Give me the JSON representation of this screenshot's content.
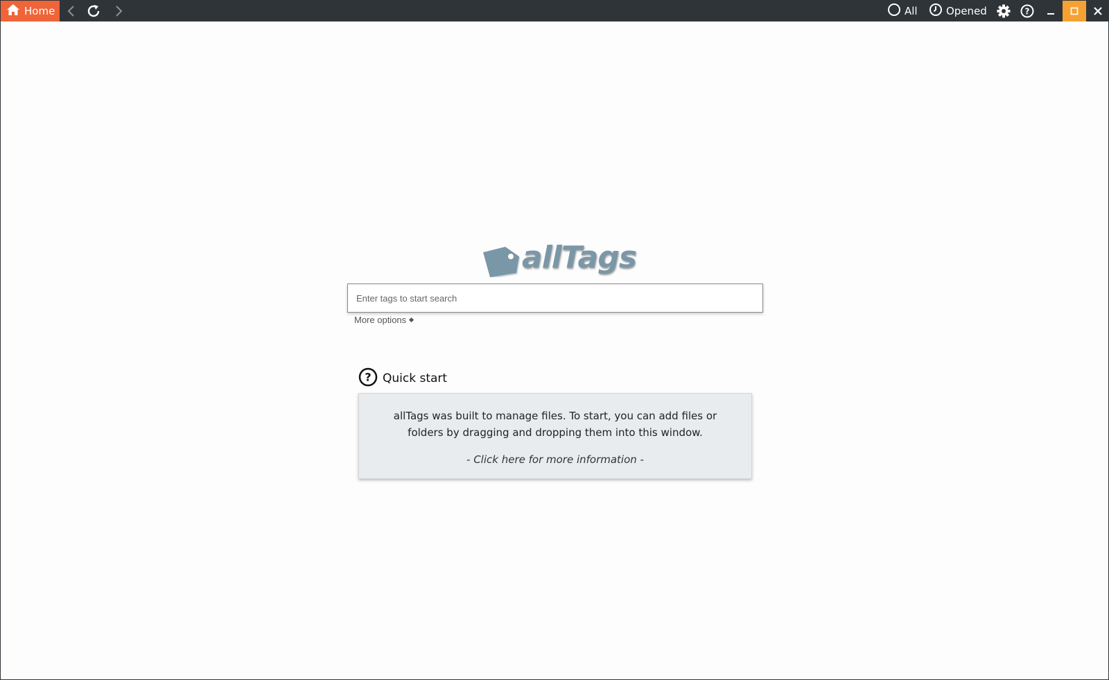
{
  "app": {
    "name": "allTags"
  },
  "titlebar": {
    "home_label": "Home",
    "filter_all_label": "All",
    "filter_opened_label": "Opened"
  },
  "colors": {
    "titlebar_bg": "#2f3439",
    "home_accent": "#f0643a",
    "maximize_accent": "#f5a134",
    "logo_color": "#7a97a7",
    "card_bg": "#e9ecee"
  },
  "logo": {
    "text": "allTags",
    "icon": "tag-icon"
  },
  "search": {
    "placeholder": "Enter tags to start search",
    "value": "",
    "more_options_label": "More options"
  },
  "quick_start": {
    "title": "Quick start",
    "body": "allTags was built to manage files. To start, you can add files or folders by dragging and dropping them into this window.",
    "link": "- Click here for more information -"
  }
}
